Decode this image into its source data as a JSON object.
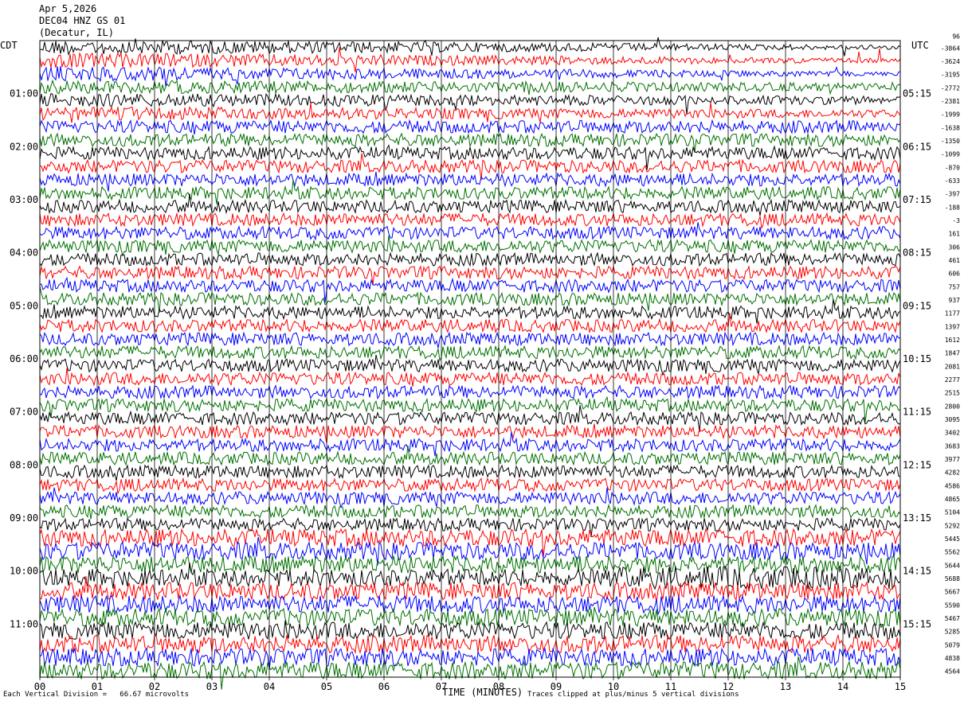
{
  "header": {
    "date": "Apr 5,2026",
    "station": "DEC04 HNZ GS 01",
    "location": "(Decatur, IL)"
  },
  "left_axis_title": "CDT",
  "right_axis_title": "UTC",
  "footer": {
    "scale_note": "Each Vertical Division =   66.67 microvolts",
    "x_title": "TIME (MINUTES)",
    "clip_note": "Traces clipped at plus/minus 5 vertical divisions"
  },
  "colors": {
    "trace_cycle": [
      "#000000",
      "#ff0000",
      "#0000ff",
      "#007000"
    ],
    "grid": "#000000"
  },
  "chart_data": {
    "type": "line",
    "title": "",
    "xlabel": "TIME (MINUTES)",
    "xlim": [
      0,
      15
    ],
    "x_ticks": [
      "00",
      "01",
      "02",
      "03",
      "04",
      "05",
      "06",
      "07",
      "08",
      "09",
      "10",
      "11",
      "12",
      "13",
      "14",
      "15"
    ],
    "row_count": 48,
    "left_hour_labels": [
      "01:00",
      "02:00",
      "03:00",
      "04:00",
      "05:00",
      "06:00",
      "07:00",
      "08:00",
      "09:00",
      "10:00",
      "11:00"
    ],
    "right_hour_labels": [
      "05:15",
      "06:15",
      "07:15",
      "08:15",
      "09:15",
      "10:15",
      "11:15",
      "12:15",
      "13:15",
      "14:15",
      "15:15"
    ],
    "hour_label_rows": [
      4,
      8,
      12,
      16,
      20,
      24,
      28,
      32,
      36,
      40,
      44
    ],
    "right_offsets": [
      "96",
      "-3864",
      "-3624",
      "-3195",
      "-2772",
      "-2381",
      "-1999",
      "-1638",
      "-1350",
      "-1099",
      "-870",
      "-633",
      "-397",
      "-188",
      "-3",
      "161",
      "306",
      "461",
      "606",
      "757",
      "937",
      "1177",
      "1397",
      "1612",
      "1847",
      "2081",
      "2277",
      "2515",
      "2800",
      "3095",
      "3402",
      "3683",
      "3977",
      "4282",
      "4586",
      "4865",
      "5104",
      "5292",
      "5445",
      "5562",
      "5644",
      "5688",
      "5667",
      "5590",
      "5467",
      "5285",
      "5079",
      "4838",
      "4564"
    ],
    "note": "Helicorder seismogram, 15 minutes per row, traces colored in a repeating black/red/blue/green cycle"
  }
}
